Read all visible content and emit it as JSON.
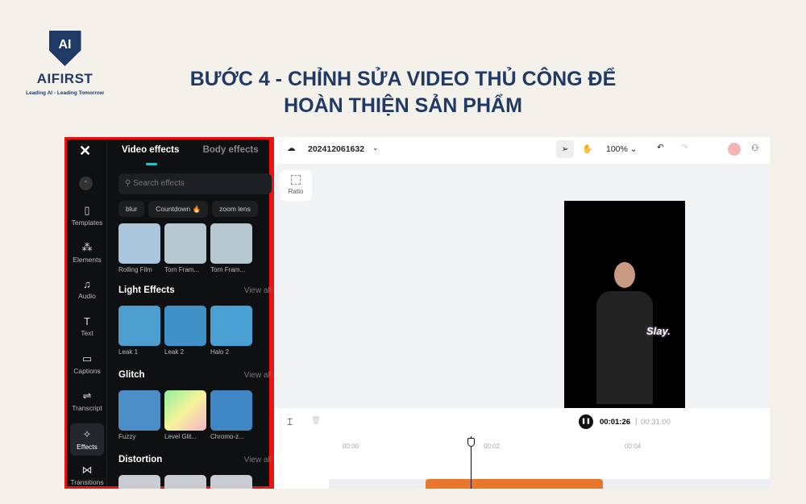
{
  "logo": {
    "mark": "AI",
    "brand": "AIFIRST",
    "tagline": "Leading AI - Leading Tomorrow"
  },
  "title": {
    "line1": "BƯỚC 4 - CHỈNH SỬA VIDEO THỦ CÔNG ĐỂ",
    "line2": "HOÀN THIỆN SẢN PHẨM"
  },
  "rail": {
    "items": [
      {
        "label": "Templates",
        "icon": "template-icon"
      },
      {
        "label": "Elements",
        "icon": "elements-icon"
      },
      {
        "label": "Audio",
        "icon": "music-icon"
      },
      {
        "label": "Text",
        "icon": "text-icon"
      },
      {
        "label": "Captions",
        "icon": "captions-icon"
      },
      {
        "label": "Transcript",
        "icon": "transcript-icon"
      },
      {
        "label": "Effects",
        "icon": "effects-icon",
        "active": true
      },
      {
        "label": "Transitions",
        "icon": "transitions-icon"
      }
    ]
  },
  "panel": {
    "tabs": [
      "Video effects",
      "Body effects"
    ],
    "search_placeholder": "Search effects",
    "chips": [
      "blur",
      "Countdown 🔥",
      "zoom lens"
    ],
    "top_row": [
      "Rolling Film",
      "Torn Fram...",
      "Torn Fram..."
    ],
    "sections": [
      {
        "title": "Light Effects",
        "view_all": "View all",
        "items": [
          "Leak 1",
          "Leak 2",
          "Halo 2"
        ]
      },
      {
        "title": "Glitch",
        "view_all": "View all",
        "items": [
          "Fuzzy",
          "Level Glit...",
          "Chromo-z..."
        ]
      },
      {
        "title": "Distortion",
        "view_all": "View all",
        "items": []
      }
    ]
  },
  "editor": {
    "project_name": "202412061632",
    "zoom": "100%",
    "ratio_label": "Ratio",
    "sticker_text": "Slay.",
    "current_time": "00:01:26",
    "total_time": "00:31:00",
    "ticks": [
      "00:00",
      "00:02",
      "00:04"
    ],
    "accent": "#e8762c"
  }
}
